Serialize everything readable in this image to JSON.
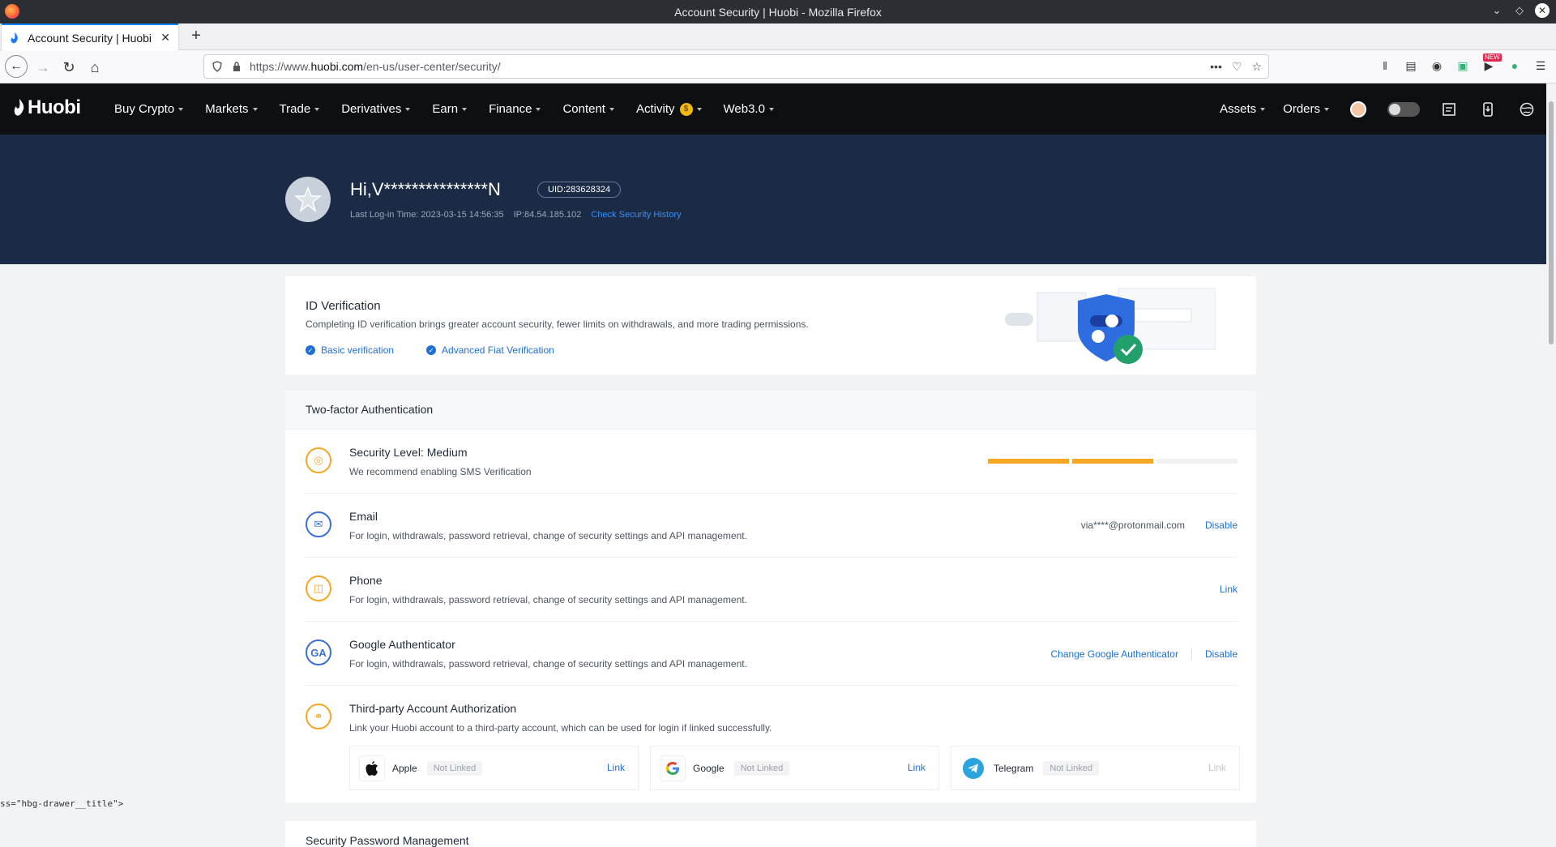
{
  "window": {
    "title": "Account Security | Huobi - Mozilla Firefox"
  },
  "tab": {
    "title": "Account Security | Huobi"
  },
  "urlbar": {
    "prefix": "https://www.",
    "domain": "huobi.com",
    "path": "/en-us/user-center/security/"
  },
  "toolbar": {
    "new_badge": "NEW"
  },
  "header": {
    "logo": "Huobi",
    "nav": [
      {
        "label": "Buy Crypto"
      },
      {
        "label": "Markets"
      },
      {
        "label": "Trade"
      },
      {
        "label": "Derivatives"
      },
      {
        "label": "Earn"
      },
      {
        "label": "Finance"
      },
      {
        "label": "Content"
      },
      {
        "label": "Activity"
      },
      {
        "label": "Web3.0"
      }
    ],
    "right_nav": [
      {
        "label": "Assets"
      },
      {
        "label": "Orders"
      }
    ]
  },
  "profile": {
    "greeting": "Hi,V***************N",
    "uid": "UID:283628324",
    "last_login": "Last Log-in Time: 2023-03-15 14:56:35",
    "ip": "IP:84.54.185.102",
    "history_link": "Check Security History"
  },
  "id_verification": {
    "title": "ID Verification",
    "description": "Completing ID verification brings greater account security, fewer limits on withdrawals, and more trading permissions.",
    "items": [
      "Basic verification",
      "Advanced Fiat Verification"
    ]
  },
  "two_factor": {
    "title": "Two-factor Authentication",
    "security_level": {
      "title": "Security Level: Medium",
      "desc": "We recommend enabling SMS Verification",
      "segments_on": 2,
      "segments_total": 3
    },
    "email": {
      "title": "Email",
      "desc": "For login, withdrawals, password retrieval, change of security settings and API management.",
      "value": "via****@protonmail.com",
      "action": "Disable"
    },
    "phone": {
      "title": "Phone",
      "desc": "For login, withdrawals, password retrieval, change of security settings and API management.",
      "action": "Link"
    },
    "google": {
      "title": "Google Authenticator",
      "desc": "For login, withdrawals, password retrieval, change of security settings and API management.",
      "change_action": "Change Google Authenticator",
      "action": "Disable",
      "icon_text": "GA"
    },
    "third_party": {
      "title": "Third-party Account Authorization",
      "desc": "Link your Huobi account to a third-party account, which can be used for login if linked successfully.",
      "accounts": [
        {
          "name": "Apple",
          "status": "Not Linked",
          "action": "Link"
        },
        {
          "name": "Google",
          "status": "Not Linked",
          "action": "Link"
        },
        {
          "name": "Telegram",
          "status": "Not Linked",
          "action": "Link"
        }
      ]
    }
  },
  "security_password": {
    "title": "Security Password Management"
  },
  "status_snippet": "ss=\"hbg-drawer__title\">",
  "colors": {
    "brand_blue": "#1f6fd6",
    "hero_bg": "#1b2a45",
    "warning_orange": "#f5a623"
  }
}
